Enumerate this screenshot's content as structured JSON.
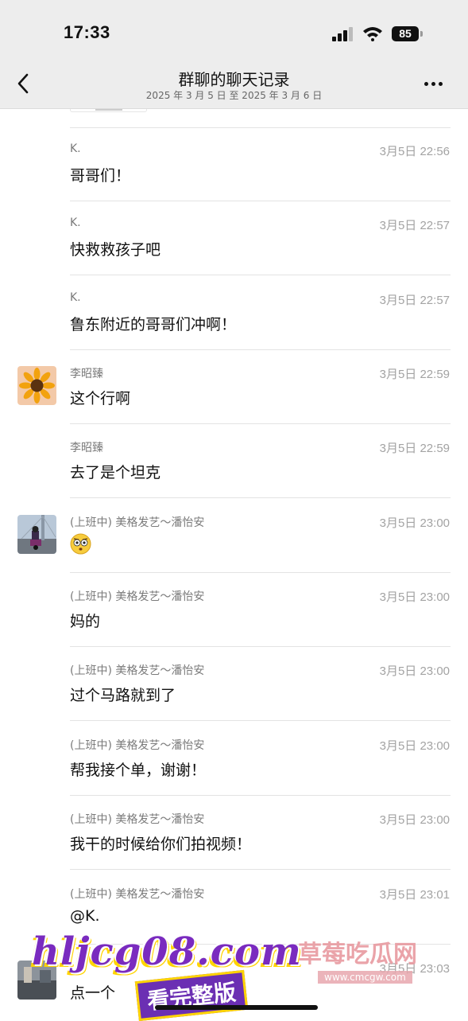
{
  "status": {
    "time": "17:33",
    "battery": "85"
  },
  "header": {
    "title": "群聊的聊天记录",
    "subtitle": "2025 年 3 月 5 日 至 2025 年 3 月 6 日"
  },
  "messages": [
    {
      "name": "K.",
      "time": "3月5日 22:56",
      "text": "哥哥们！",
      "avatar": "none"
    },
    {
      "name": "K.",
      "time": "3月5日 22:57",
      "text": "快救救孩子吧",
      "avatar": "none"
    },
    {
      "name": "K.",
      "time": "3月5日 22:57",
      "text": "鲁东附近的哥哥们冲啊！",
      "avatar": "none"
    },
    {
      "name": "李昭臻",
      "time": "3月5日 22:59",
      "text": "这个行啊",
      "avatar": "sunflower-avatar"
    },
    {
      "name": "李昭臻",
      "time": "3月5日 22:59",
      "text": "去了是个坦克",
      "avatar": "none"
    },
    {
      "name": "(上班中) 美格发艺～潘怡安",
      "time": "3月5日 23:00",
      "text": "",
      "emoji": "surprised-face-emoji",
      "avatar": "motorcycle-avatar"
    },
    {
      "name": "(上班中) 美格发艺～潘怡安",
      "time": "3月5日 23:00",
      "text": "妈的",
      "avatar": "none"
    },
    {
      "name": "(上班中) 美格发艺～潘怡安",
      "time": "3月5日 23:00",
      "text": "过个马路就到了",
      "avatar": "none"
    },
    {
      "name": "(上班中) 美格发艺～潘怡安",
      "time": "3月5日 23:00",
      "text": "帮我接个单，谢谢！",
      "avatar": "none"
    },
    {
      "name": "(上班中) 美格发艺～潘怡安",
      "time": "3月5日 23:00",
      "text": "我干的时候给你们拍视频！",
      "avatar": "none"
    },
    {
      "name": "(上班中) 美格发艺～潘怡安",
      "time": "3月5日 23:01",
      "text": "@K.",
      "avatar": "none"
    },
    {
      "name": "",
      "time": "3月5日 23:03",
      "text": "点一个",
      "avatar": "street-avatar"
    }
  ],
  "watermark": {
    "site": "hljcg08.com",
    "cn": "草莓吃瓜网",
    "url": "www.cmcgw.com",
    "badge": "看完整版"
  },
  "colors": {
    "header_bg": "#ededed",
    "divider": "#e3e3e3",
    "time": "#a3a3a3",
    "name": "#7a7a7a"
  }
}
